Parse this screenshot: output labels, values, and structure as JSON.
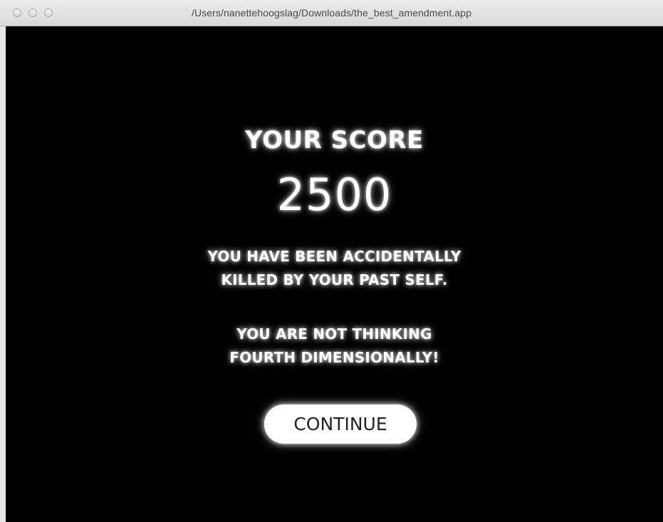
{
  "window": {
    "title": "/Users/nanettehoogslag/Downloads/the_best_amendment.app"
  },
  "game": {
    "score_heading": "YOUR SCORE",
    "score_value": "2500",
    "message1_line1": "YOU HAVE BEEN ACCIDENTALLY",
    "message1_line2": "KILLED BY YOUR PAST SELF.",
    "message2_line1": "YOU ARE NOT THINKING",
    "message2_line2": "FOURTH DIMENSIONALLY!",
    "continue_label": "CONTINUE"
  },
  "colors": {
    "background": "#000000",
    "text": "#ffffff",
    "button_bg": "#ffffff",
    "button_text": "#222222"
  }
}
